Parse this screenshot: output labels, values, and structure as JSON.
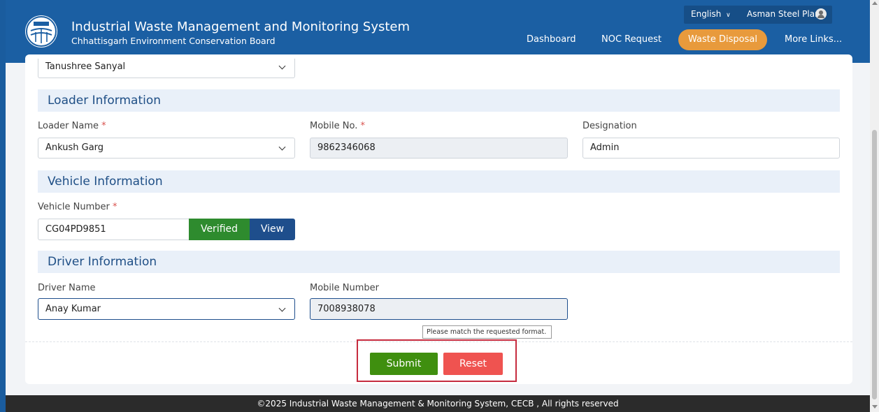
{
  "header": {
    "title": "Industrial Waste Management and Monitoring System",
    "subtitle": "Chhattisgarh Environment Conservation Board",
    "language": "English",
    "user_name": "Asman Steel Plant",
    "nav": [
      "Dashboard",
      "NOC Request",
      "Waste Disposal",
      "More Links..."
    ],
    "active_nav": "Waste Disposal"
  },
  "form": {
    "top_select_value": "Tanushree Sanyal",
    "loader_section": {
      "title": "Loader Information",
      "name_label": "Loader Name",
      "name_value": "Ankush Garg",
      "mobile_label": "Mobile No.",
      "mobile_value": "9862346068",
      "designation_label": "Designation",
      "designation_value": "Admin"
    },
    "vehicle_section": {
      "title": "Vehicle Information",
      "number_label": "Vehicle Number",
      "number_value": "CG04PD9851",
      "verified_label": "Verified",
      "view_label": "View"
    },
    "driver_section": {
      "title": "Driver Information",
      "name_label": "Driver Name",
      "name_value": "Anay Kumar",
      "mobile_label": "Mobile Number",
      "mobile_value": "7008938078"
    },
    "tooltip": "Please match the requested format.",
    "required_mark": "*",
    "submit_label": "Submit",
    "reset_label": "Reset"
  },
  "footer": {
    "text": "©2025 Industrial Waste Management & Monitoring System, CECB , All rights reserved"
  },
  "colors": {
    "header_bg": "#1b5fa3",
    "active_nav_bg": "#e89a3c",
    "section_bg": "#e9f0f9",
    "section_title": "#1f4f86",
    "verified_bg": "#2e8b2e",
    "view_bg": "#1e4e8c",
    "submit_bg": "#3f8f0f",
    "reset_bg": "#ef5350",
    "highlight_border": "#c62b3e",
    "footer_bg": "#2b2b2b"
  }
}
